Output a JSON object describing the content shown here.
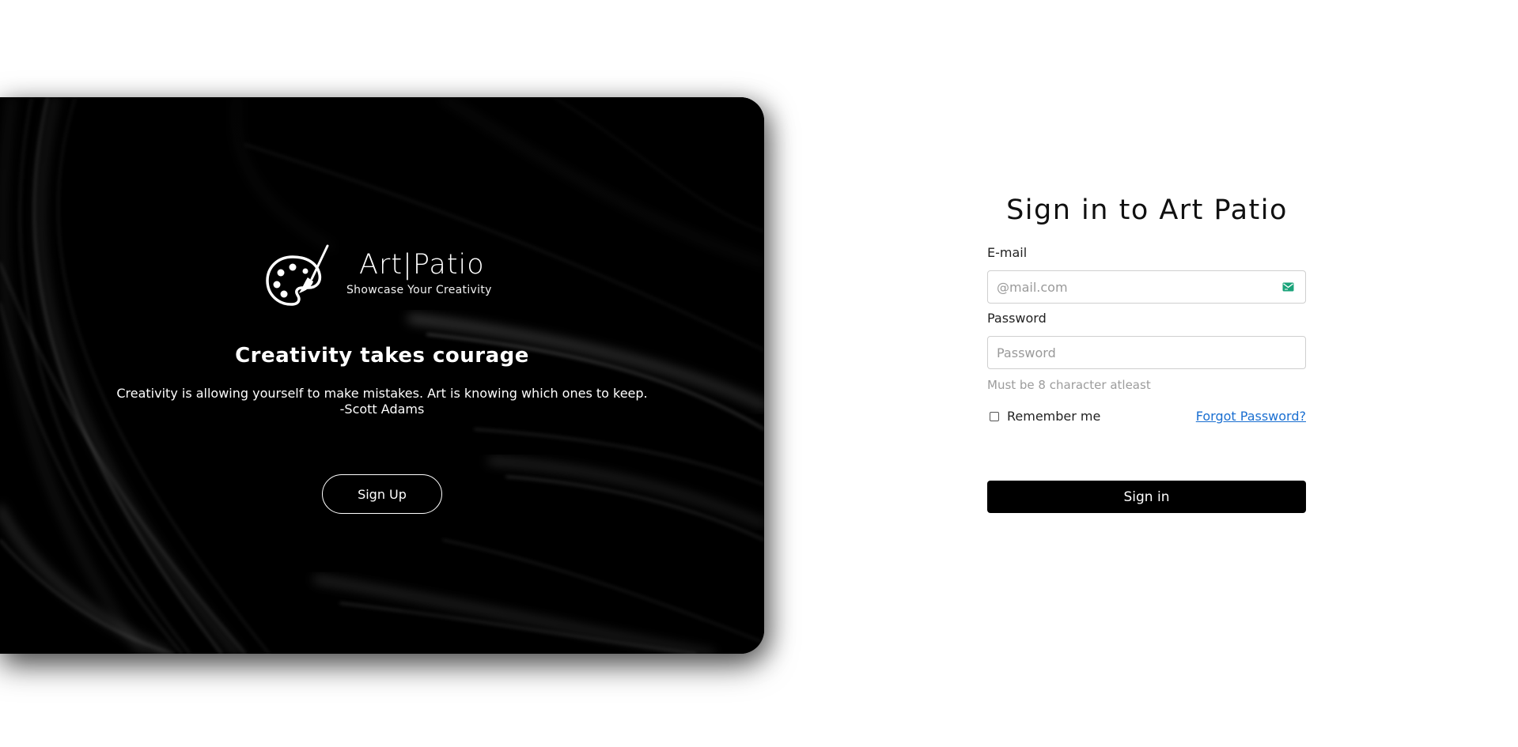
{
  "hero": {
    "brand": "Art|Patio",
    "tagline": "Showcase Your Creativity",
    "title": "Creativity takes courage",
    "quote": "Creativity is allowing yourself to make mistakes. Art is knowing which ones to keep.",
    "author": "-Scott Adams",
    "signup_label": "Sign Up"
  },
  "form": {
    "title": "Sign in to Art Patio",
    "email_label": "E-mail",
    "email_placeholder": "@mail.com",
    "email_value": "",
    "password_label": "Password",
    "password_placeholder": "Password",
    "password_value": "",
    "password_hint": "Must be 8 character atleast",
    "remember_label": "Remember me",
    "remember_checked": false,
    "forgot_label": "Forgot Password?",
    "signin_label": "Sign in"
  },
  "icons": {
    "logo": "palette-brush-icon",
    "email": "mail-icon"
  },
  "colors": {
    "hero_bg": "#000000",
    "primary_button": "#000000",
    "link": "#1a6fd1",
    "mail_icon": "#1aa37a"
  }
}
